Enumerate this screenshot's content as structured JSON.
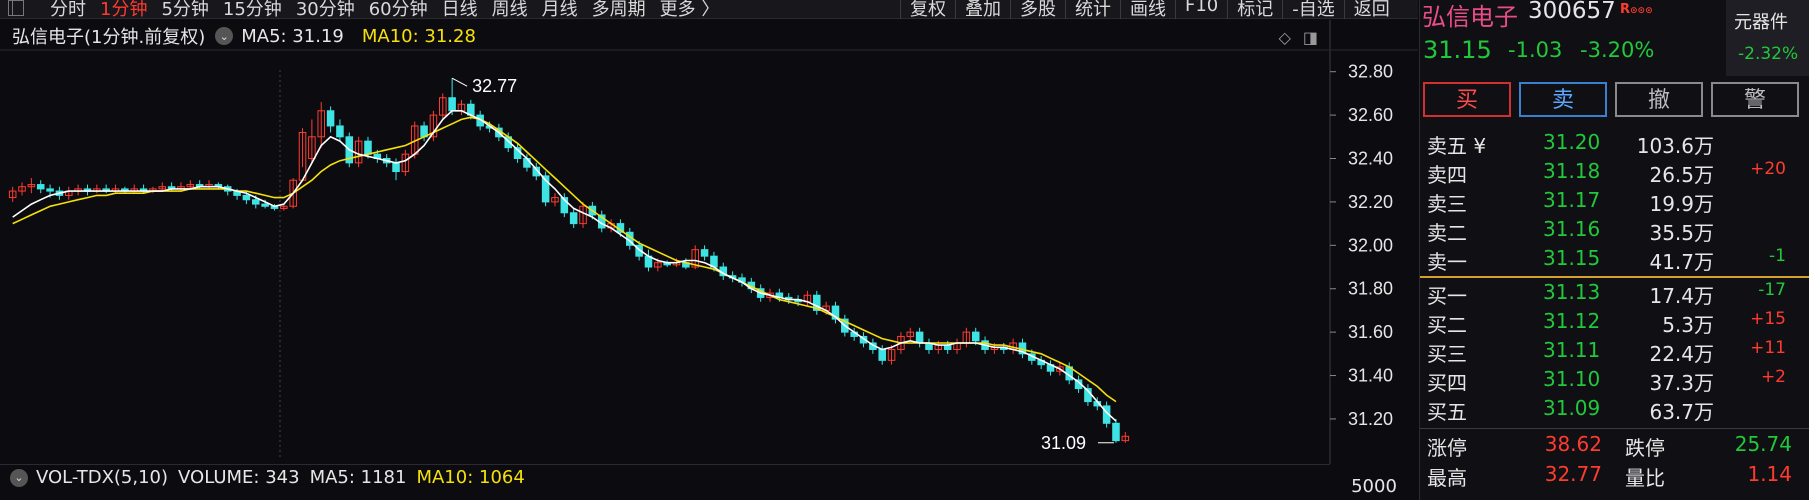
{
  "toolbar": {
    "tabs": [
      "分时",
      "1分钟",
      "5分钟",
      "15分钟",
      "30分钟",
      "60分钟",
      "日线",
      "周线",
      "月线",
      "多周期",
      "更多 〉"
    ],
    "active_tab": "1分钟",
    "buttons": [
      "复权",
      "叠加",
      "多股",
      "统计",
      "画线",
      "F10",
      "标记",
      "-自选",
      "返回"
    ]
  },
  "chart": {
    "stock_label": "弘信电子(1分钟.前复权)",
    "ma5_label": "MA5: 31.19",
    "ma10_label": "MA10: 31.28",
    "high_marker": "32.77",
    "low_marker": "31.09"
  },
  "chart_data": {
    "type": "candlestick",
    "y_ticks": [
      32.8,
      32.6,
      32.4,
      32.2,
      32.0,
      31.8,
      31.6,
      31.4,
      31.2
    ],
    "ylim": [
      31.02,
      32.9
    ],
    "candles": [
      [
        32.22,
        32.25,
        32.2,
        32.27
      ],
      [
        32.25,
        32.27,
        32.23,
        32.29
      ],
      [
        32.27,
        32.28,
        32.24,
        32.31
      ],
      [
        32.28,
        32.26,
        32.24,
        32.3
      ],
      [
        32.26,
        32.25,
        32.22,
        32.28
      ],
      [
        32.25,
        32.23,
        32.21,
        32.27
      ],
      [
        32.23,
        32.25,
        32.21,
        32.27
      ],
      [
        32.25,
        32.26,
        32.23,
        32.28
      ],
      [
        32.26,
        32.25,
        32.23,
        32.28
      ],
      [
        32.25,
        32.26,
        32.24,
        32.28
      ],
      [
        32.26,
        32.25,
        32.24,
        32.28
      ],
      [
        32.25,
        32.26,
        32.24,
        32.28
      ],
      [
        32.26,
        32.25,
        32.24,
        32.27
      ],
      [
        32.25,
        32.26,
        32.24,
        32.28
      ],
      [
        32.26,
        32.25,
        32.24,
        32.28
      ],
      [
        32.25,
        32.26,
        32.24,
        32.27
      ],
      [
        32.26,
        32.27,
        32.25,
        32.29
      ],
      [
        32.27,
        32.26,
        32.25,
        32.29
      ],
      [
        32.26,
        32.27,
        32.25,
        32.29
      ],
      [
        32.27,
        32.28,
        32.26,
        32.3
      ],
      [
        32.28,
        32.27,
        32.26,
        32.3
      ],
      [
        32.27,
        32.28,
        32.26,
        32.3
      ],
      [
        32.28,
        32.27,
        32.26,
        32.29
      ],
      [
        32.27,
        32.25,
        32.23,
        32.28
      ],
      [
        32.25,
        32.23,
        32.21,
        32.26
      ],
      [
        32.23,
        32.21,
        32.19,
        32.25
      ],
      [
        32.21,
        32.19,
        32.17,
        32.23
      ],
      [
        32.19,
        32.18,
        32.17,
        32.21
      ],
      [
        32.18,
        32.17,
        32.16,
        32.19
      ],
      [
        32.17,
        32.18,
        32.16,
        32.19
      ],
      [
        32.18,
        32.3,
        32.17,
        32.31
      ],
      [
        32.3,
        32.52,
        32.36,
        32.54
      ],
      [
        32.4,
        32.5,
        32.38,
        32.58
      ],
      [
        32.5,
        32.62,
        32.45,
        32.66
      ],
      [
        32.62,
        32.55,
        32.52,
        32.64
      ],
      [
        32.55,
        32.5,
        32.48,
        32.58
      ],
      [
        32.5,
        32.38,
        32.36,
        32.52
      ],
      [
        32.38,
        32.48,
        32.36,
        32.5
      ],
      [
        32.48,
        32.42,
        32.4,
        32.5
      ],
      [
        32.42,
        32.4,
        32.38,
        32.44
      ],
      [
        32.4,
        32.38,
        32.36,
        32.42
      ],
      [
        32.38,
        32.34,
        32.3,
        32.4
      ],
      [
        32.34,
        32.42,
        32.32,
        32.44
      ],
      [
        32.42,
        32.55,
        32.4,
        32.57
      ],
      [
        32.55,
        32.5,
        32.48,
        32.57
      ],
      [
        32.5,
        32.6,
        32.48,
        32.62
      ],
      [
        32.6,
        32.68,
        32.58,
        32.7
      ],
      [
        32.68,
        32.62,
        32.6,
        32.77
      ],
      [
        32.62,
        32.65,
        32.6,
        32.67
      ],
      [
        32.65,
        32.6,
        32.58,
        32.67
      ],
      [
        32.6,
        32.55,
        32.53,
        32.62
      ],
      [
        32.55,
        32.54,
        32.52,
        32.57
      ],
      [
        32.54,
        32.5,
        32.48,
        32.56
      ],
      [
        32.5,
        32.45,
        32.43,
        32.52
      ],
      [
        32.45,
        32.4,
        32.38,
        32.47
      ],
      [
        32.4,
        32.36,
        32.34,
        32.42
      ],
      [
        32.36,
        32.32,
        32.3,
        32.38
      ],
      [
        32.32,
        32.2,
        32.18,
        32.34
      ],
      [
        32.2,
        32.22,
        32.18,
        32.24
      ],
      [
        32.22,
        32.15,
        32.13,
        32.24
      ],
      [
        32.15,
        32.1,
        32.08,
        32.17
      ],
      [
        32.1,
        32.18,
        32.08,
        32.2
      ],
      [
        32.18,
        32.14,
        32.12,
        32.2
      ],
      [
        32.14,
        32.08,
        32.06,
        32.16
      ],
      [
        32.08,
        32.1,
        32.06,
        32.12
      ],
      [
        32.1,
        32.06,
        32.04,
        32.12
      ],
      [
        32.06,
        32.0,
        31.98,
        32.08
      ],
      [
        32.0,
        31.95,
        31.93,
        32.02
      ],
      [
        31.95,
        31.9,
        31.88,
        31.98
      ],
      [
        31.9,
        31.92,
        31.88,
        31.94
      ],
      [
        31.92,
        31.91,
        31.9,
        31.93
      ],
      [
        31.91,
        31.92,
        31.9,
        31.94
      ],
      [
        31.92,
        31.9,
        31.89,
        31.94
      ],
      [
        31.9,
        31.98,
        31.89,
        32.0
      ],
      [
        31.98,
        31.95,
        31.93,
        32.0
      ],
      [
        31.95,
        31.9,
        31.88,
        31.97
      ],
      [
        31.9,
        31.86,
        31.84,
        31.92
      ],
      [
        31.86,
        31.85,
        31.83,
        31.88
      ],
      [
        31.85,
        31.83,
        31.81,
        31.87
      ],
      [
        31.83,
        31.8,
        31.78,
        31.85
      ],
      [
        31.8,
        31.76,
        31.74,
        31.82
      ],
      [
        31.76,
        31.78,
        31.74,
        31.8
      ],
      [
        31.78,
        31.76,
        31.74,
        31.8
      ],
      [
        31.76,
        31.75,
        31.73,
        31.78
      ],
      [
        31.75,
        31.74,
        31.72,
        31.77
      ],
      [
        31.74,
        31.77,
        31.72,
        31.79
      ],
      [
        31.77,
        31.7,
        31.68,
        31.79
      ],
      [
        31.7,
        31.72,
        31.68,
        31.74
      ],
      [
        31.72,
        31.66,
        31.64,
        31.74
      ],
      [
        31.66,
        31.6,
        31.58,
        31.68
      ],
      [
        31.6,
        31.58,
        31.56,
        31.62
      ],
      [
        31.58,
        31.55,
        31.53,
        31.6
      ],
      [
        31.55,
        31.52,
        31.5,
        31.57
      ],
      [
        31.52,
        31.47,
        31.45,
        31.54
      ],
      [
        31.47,
        31.52,
        31.45,
        31.54
      ],
      [
        31.52,
        31.58,
        31.5,
        31.6
      ],
      [
        31.58,
        31.6,
        31.56,
        31.62
      ],
      [
        31.6,
        31.55,
        31.53,
        31.62
      ],
      [
        31.55,
        31.52,
        31.5,
        31.57
      ],
      [
        31.52,
        31.54,
        31.5,
        31.56
      ],
      [
        31.54,
        31.52,
        31.5,
        31.56
      ],
      [
        31.52,
        31.55,
        31.5,
        31.57
      ],
      [
        31.55,
        31.6,
        31.53,
        31.62
      ],
      [
        31.6,
        31.56,
        31.54,
        31.62
      ],
      [
        31.56,
        31.52,
        31.5,
        31.58
      ],
      [
        31.52,
        31.53,
        31.5,
        31.55
      ],
      [
        31.53,
        31.52,
        31.5,
        31.55
      ],
      [
        31.52,
        31.55,
        31.5,
        31.57
      ],
      [
        31.55,
        31.5,
        31.48,
        31.57
      ],
      [
        31.5,
        31.47,
        31.45,
        31.52
      ],
      [
        31.47,
        31.45,
        31.43,
        31.49
      ],
      [
        31.45,
        31.42,
        31.4,
        31.47
      ],
      [
        31.42,
        31.44,
        31.4,
        31.46
      ],
      [
        31.44,
        31.38,
        31.36,
        31.46
      ],
      [
        31.38,
        31.34,
        31.32,
        31.4
      ],
      [
        31.34,
        31.28,
        31.26,
        31.36
      ],
      [
        31.28,
        31.26,
        31.24,
        31.3
      ],
      [
        31.26,
        31.18,
        31.16,
        31.28
      ],
      [
        31.18,
        31.1,
        31.09,
        31.2
      ],
      [
        31.1,
        31.12,
        31.09,
        31.14
      ]
    ],
    "ma5": [
      32.13,
      32.16,
      32.19,
      32.21,
      32.23,
      32.24,
      32.25,
      32.25,
      32.25,
      32.25,
      32.25,
      32.25,
      32.25,
      32.25,
      32.25,
      32.25,
      32.25,
      32.26,
      32.26,
      32.26,
      32.27,
      32.27,
      32.27,
      32.26,
      32.25,
      32.24,
      32.22,
      32.2,
      32.18,
      32.19,
      32.24,
      32.3,
      32.38,
      32.46,
      32.5,
      32.48,
      32.44,
      32.42,
      32.41,
      32.4,
      32.39,
      32.38,
      32.39,
      32.42,
      32.46,
      32.52,
      32.58,
      32.62,
      32.62,
      32.6,
      32.58,
      32.55,
      32.52,
      32.48,
      32.44,
      32.4,
      32.35,
      32.3,
      32.26,
      32.21,
      32.17,
      32.15,
      32.13,
      32.1,
      32.08,
      32.05,
      32.02,
      31.98,
      31.95,
      31.93,
      31.92,
      31.92,
      31.93,
      31.93,
      31.92,
      31.9,
      31.87,
      31.85,
      31.83,
      31.8,
      31.78,
      31.77,
      31.76,
      31.75,
      31.75,
      31.74,
      31.72,
      31.7,
      31.67,
      31.63,
      31.6,
      31.57,
      31.54,
      31.52,
      31.53,
      31.55,
      31.56,
      31.55,
      31.55,
      31.54,
      31.54,
      31.55,
      31.55,
      31.55,
      31.54,
      31.53,
      31.53,
      31.52,
      31.51,
      31.49,
      31.47,
      31.45,
      31.43,
      31.4,
      31.37,
      31.33,
      31.28,
      31.23,
      31.19
    ],
    "ma10": [
      32.1,
      32.12,
      32.14,
      32.16,
      32.18,
      32.19,
      32.2,
      32.21,
      32.22,
      32.23,
      32.23,
      32.24,
      32.24,
      32.24,
      32.24,
      32.25,
      32.25,
      32.25,
      32.25,
      32.26,
      32.26,
      32.26,
      32.26,
      32.26,
      32.25,
      32.25,
      32.24,
      32.23,
      32.22,
      32.22,
      32.24,
      32.27,
      32.3,
      32.34,
      32.37,
      32.39,
      32.4,
      32.41,
      32.42,
      32.43,
      32.44,
      32.45,
      32.46,
      32.48,
      32.5,
      32.52,
      32.54,
      32.56,
      32.58,
      32.59,
      32.58,
      32.56,
      32.53,
      32.5,
      32.47,
      32.43,
      32.39,
      32.35,
      32.31,
      32.27,
      32.23,
      32.19,
      32.16,
      32.13,
      32.1,
      32.07,
      32.04,
      32.01,
      31.99,
      31.97,
      31.95,
      31.93,
      31.92,
      31.91,
      31.9,
      31.89,
      31.87,
      31.85,
      31.83,
      31.81,
      31.79,
      31.77,
      31.75,
      31.74,
      31.73,
      31.72,
      31.71,
      31.69,
      31.67,
      31.65,
      31.63,
      31.61,
      31.59,
      31.57,
      31.56,
      31.55,
      31.55,
      31.55,
      31.55,
      31.55,
      31.55,
      31.55,
      31.55,
      31.55,
      31.55,
      31.54,
      31.54,
      31.53,
      31.52,
      31.51,
      31.5,
      31.48,
      31.46,
      31.44,
      31.41,
      31.38,
      31.35,
      31.31,
      31.28
    ]
  },
  "volume": {
    "title": "VOL-TDX(5,10)",
    "volume_label": "VOLUME: 343",
    "ma5_label": "MA5: 1181",
    "ma10_label": "MA10: 1064",
    "axis_top": "5000"
  },
  "quote": {
    "name": "弘信电子",
    "code": "300657",
    "badge": "R",
    "price": "31.15",
    "change": "-1.03",
    "change_pct": "-3.20%",
    "sector_name": "元器件",
    "sector_pct": "-2.32%"
  },
  "trade_buttons": {
    "buy": "买",
    "sell": "卖",
    "cancel": "撤",
    "alert": "警"
  },
  "order_book": {
    "asks": [
      {
        "label": "卖五 ¥",
        "price": "31.20",
        "volume": "103.6万",
        "change": ""
      },
      {
        "label": "卖四",
        "price": "31.18",
        "volume": "26.5万",
        "change": "+20"
      },
      {
        "label": "卖三",
        "price": "31.17",
        "volume": "19.9万",
        "change": ""
      },
      {
        "label": "卖二",
        "price": "31.16",
        "volume": "35.5万",
        "change": ""
      },
      {
        "label": "卖一",
        "price": "31.15",
        "volume": "41.7万",
        "change": "-1"
      }
    ],
    "bids": [
      {
        "label": "买一",
        "price": "31.13",
        "volume": "17.4万",
        "change": "-17"
      },
      {
        "label": "买二",
        "price": "31.12",
        "volume": "5.3万",
        "change": "+15"
      },
      {
        "label": "买三",
        "price": "31.11",
        "volume": "22.4万",
        "change": "+11"
      },
      {
        "label": "买四",
        "price": "31.10",
        "volume": "37.3万",
        "change": "+2"
      },
      {
        "label": "买五",
        "price": "31.09",
        "volume": "63.7万",
        "change": ""
      }
    ]
  },
  "stats": {
    "limit_up_label": "涨停",
    "limit_up": "38.62",
    "limit_down_label": "跌停",
    "limit_down": "25.74",
    "high_label": "最高",
    "high": "32.77",
    "vol_ratio_label": "量比",
    "vol_ratio": "1.14"
  },
  "colors": {
    "up": "#ff3b30",
    "down": "#3ee4e4",
    "ma5": "#ffffff",
    "ma10": "#f5e00b"
  }
}
